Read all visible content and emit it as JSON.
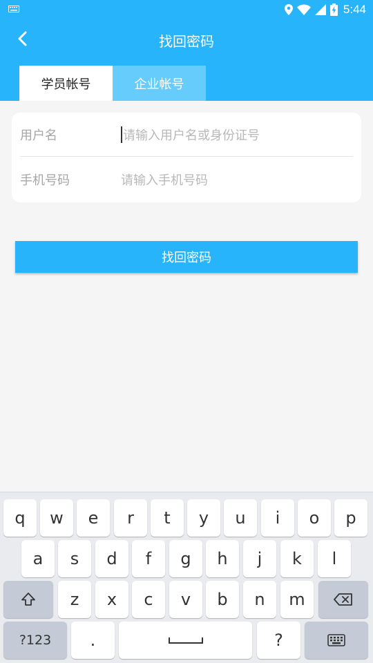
{
  "status_bar": {
    "time": "5:44",
    "icons": [
      "keyboard-icon",
      "location-icon",
      "wifi-icon",
      "signal-icon",
      "battery-charging-icon"
    ]
  },
  "app_bar": {
    "back_icon": "chevron-left-icon",
    "title": "找回密码"
  },
  "tabs": [
    {
      "label": "学员帐号",
      "active": true
    },
    {
      "label": "企业帐号",
      "active": false
    }
  ],
  "form": {
    "username": {
      "label": "用户名",
      "placeholder": "请输入用户名或身份证号",
      "value": ""
    },
    "phone": {
      "label": "手机号码",
      "placeholder": "请输入手机号码",
      "value": ""
    }
  },
  "submit_label": "找回密码",
  "keyboard": {
    "row1": [
      "q",
      "w",
      "e",
      "r",
      "t",
      "y",
      "u",
      "i",
      "o",
      "p"
    ],
    "row2": [
      "a",
      "s",
      "d",
      "f",
      "g",
      "h",
      "j",
      "k",
      "l"
    ],
    "row3": [
      "z",
      "x",
      "c",
      "v",
      "b",
      "n",
      "m"
    ],
    "shift_icon": "shift-icon",
    "backspace_icon": "backspace-icon",
    "symbols_label": "?123",
    "period_label": ".",
    "space_icon": "spacebar-icon",
    "question_label": "?",
    "keyboard_icon": "keyboard-icon"
  },
  "colors": {
    "primary": "#27b4fa",
    "tab_inactive": "#66ccfb",
    "background": "#f5f5f5"
  }
}
